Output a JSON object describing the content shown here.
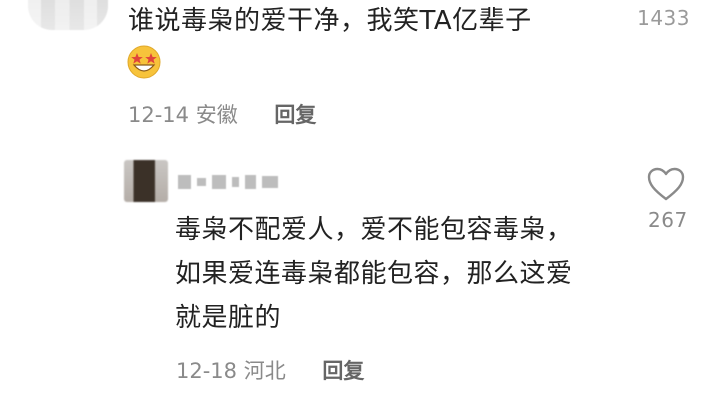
{
  "top_comment": {
    "text": "谁说毒枭的爱干净，我笑TA亿辈子",
    "emoji": "grinning-star-eyes-emoji",
    "date": "12-14",
    "location": "安徽",
    "reply_label": "回复",
    "like_count": "1433"
  },
  "reply": {
    "text": "毒枭不配爱人，爱不能包容毒枭，如果爱连毒枭都能包容，那么这爱就是脏的",
    "date": "12-18",
    "location": "河北",
    "reply_label": "回复",
    "like_count": "267",
    "like_icon": "heart-outline-icon"
  },
  "colors": {
    "text_primary": "#222222",
    "text_meta": "#8a8a8a",
    "like_count": "#9a9a9a"
  }
}
